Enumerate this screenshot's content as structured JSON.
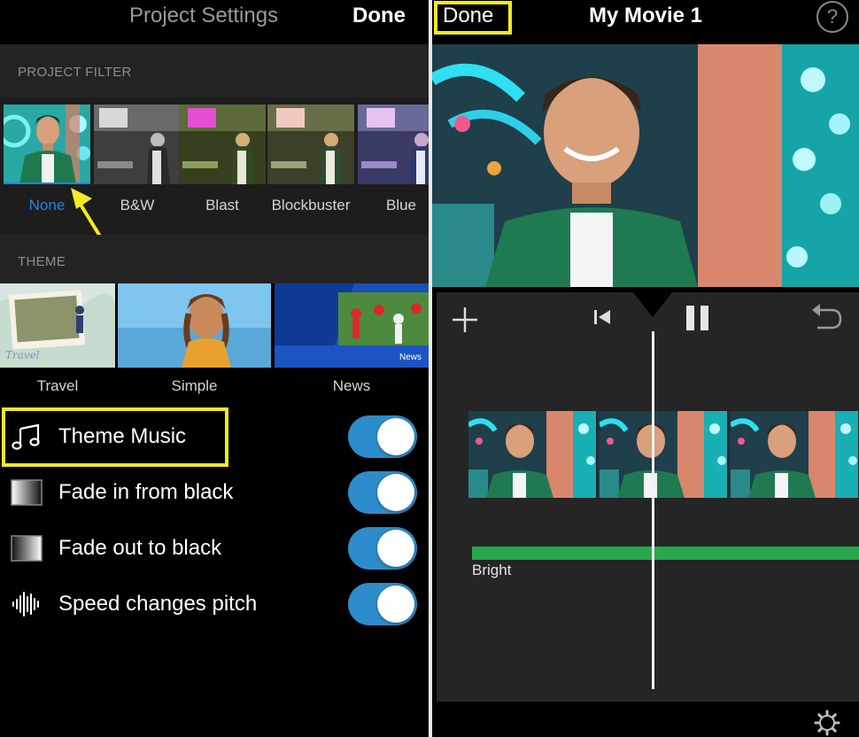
{
  "left_panel": {
    "title": "Project Settings",
    "done_label": "Done",
    "filter_section": "PROJECT FILTER",
    "filters": [
      {
        "label": "None",
        "selected": true
      },
      {
        "label": "B&W",
        "selected": false
      },
      {
        "label": "Blast",
        "selected": false
      },
      {
        "label": "Blockbuster",
        "selected": false
      },
      {
        "label": "Blue",
        "selected": false
      }
    ],
    "theme_section": "THEME",
    "themes": [
      {
        "label": "Travel",
        "thumb_text": "Travel"
      },
      {
        "label": "Simple",
        "thumb_text": ""
      },
      {
        "label": "News",
        "thumb_text": "News"
      }
    ],
    "settings": [
      {
        "label": "Theme Music",
        "icon": "music-note-icon",
        "on": true
      },
      {
        "label": "Fade in from black",
        "icon": "fade-in-icon",
        "on": true
      },
      {
        "label": "Fade out to black",
        "icon": "fade-out-icon",
        "on": true
      },
      {
        "label": "Speed changes pitch",
        "icon": "waveform-icon",
        "on": true
      }
    ]
  },
  "right_panel": {
    "done_label": "Done",
    "title": "My Movie 1",
    "help_label": "?",
    "audio_clip_label": "Bright"
  },
  "colors": {
    "accent_blue": "#1e88e5",
    "toggle_on": "#2d8ccb",
    "highlight": "#f3ea24",
    "audio_green": "#27a84a"
  }
}
